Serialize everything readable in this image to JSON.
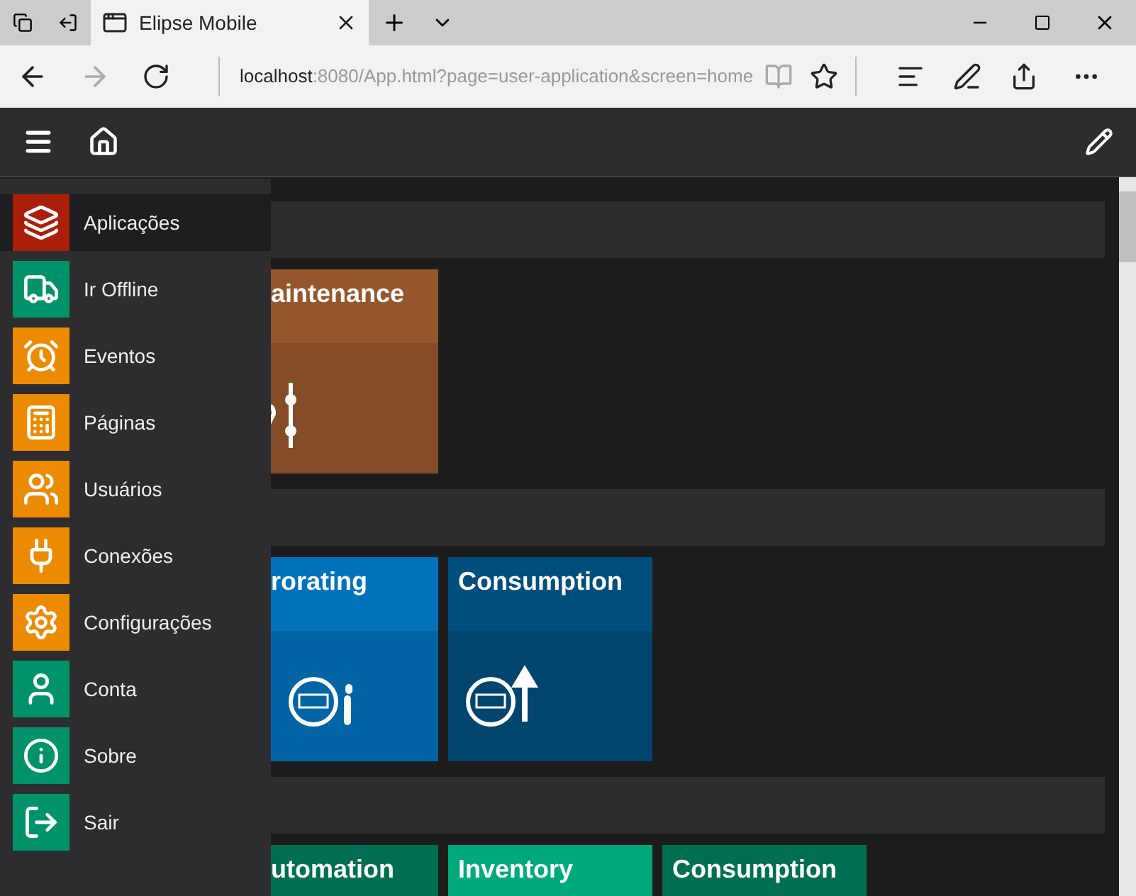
{
  "browser": {
    "tab_title": "Elipse Mobile",
    "address_host": "localhost",
    "address_rest": ":8080/App.html?page=user-application&screen=home"
  },
  "menu": [
    {
      "label": "Aplicações",
      "color": "#aa1f0a",
      "selected": true
    },
    {
      "label": "Ir Offline",
      "color": "#00936a",
      "selected": false
    },
    {
      "label": "Eventos",
      "color": "#ec8a00",
      "selected": false
    },
    {
      "label": "Páginas",
      "color": "#ec8a00",
      "selected": false
    },
    {
      "label": "Usuários",
      "color": "#ec8a00",
      "selected": false
    },
    {
      "label": "Conexões",
      "color": "#ec8a00",
      "selected": false
    },
    {
      "label": "Configurações",
      "color": "#ec8a00",
      "selected": false
    },
    {
      "label": "Conta",
      "color": "#00936a",
      "selected": false
    },
    {
      "label": "Sobre",
      "color": "#00936a",
      "selected": false
    },
    {
      "label": "Sair",
      "color": "#00936a",
      "selected": false
    }
  ],
  "groups": [
    {
      "tiles": [
        {
          "title": "aintenance",
          "color": "#96562c"
        }
      ]
    },
    {
      "tiles": [
        {
          "title": "rorating",
          "color": "#0072bb"
        },
        {
          "title": "Consumption",
          "color": "#004e7c"
        }
      ]
    },
    {
      "tiles": [
        {
          "title": "utomation",
          "color": "#006e50"
        },
        {
          "title": "Inventory",
          "color": "#00a97c"
        },
        {
          "title": "Consumption",
          "color": "#006e50"
        }
      ]
    }
  ]
}
